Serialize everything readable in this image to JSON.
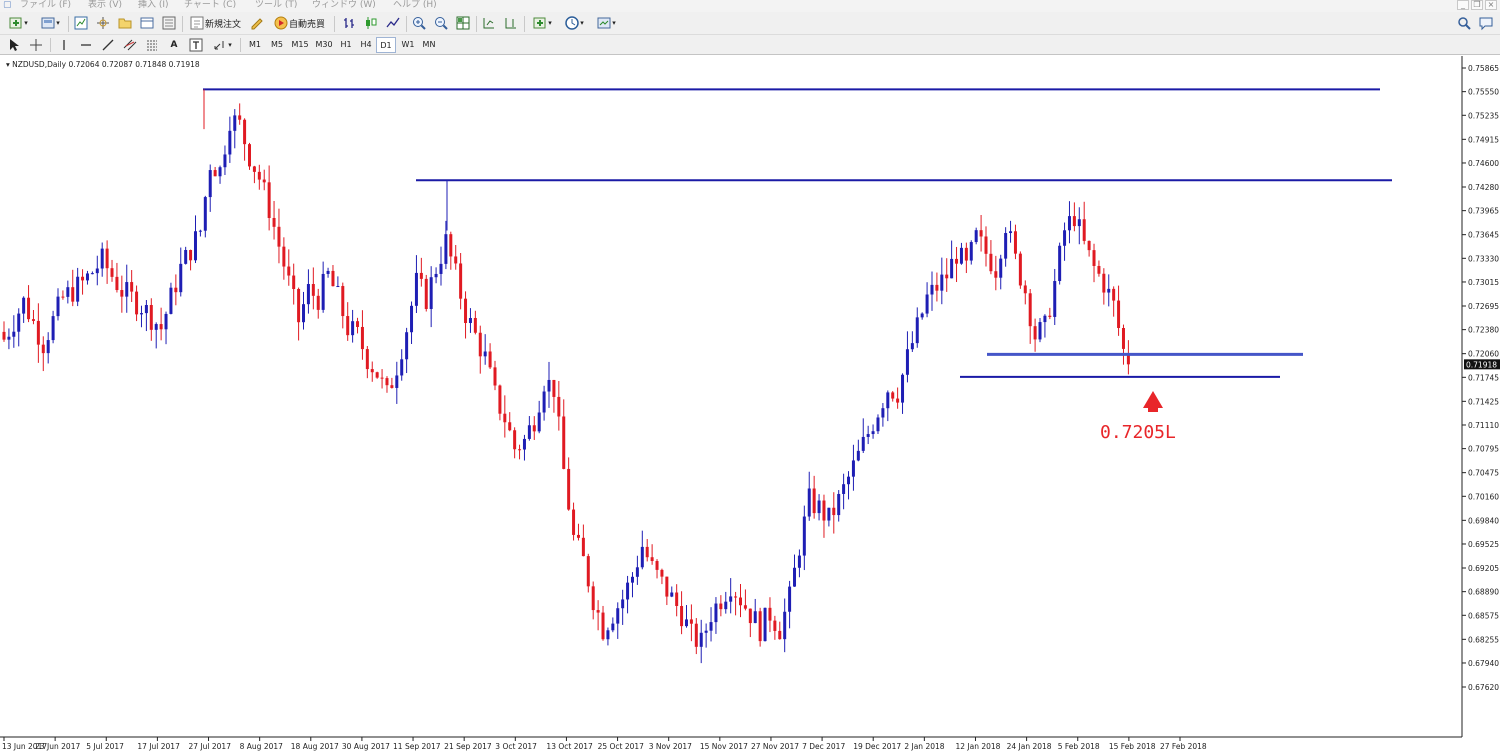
{
  "menu": {
    "items": [
      "ファイル (F)",
      "表示 (V)",
      "挿入 (I)",
      "チャート (C)",
      "ツール (T)",
      "ウィンドウ (W)",
      "ヘルプ (H)"
    ]
  },
  "toolbar": {
    "new_order_label": "新規注文",
    "auto_trade_label": "自動売買",
    "timeframes": [
      "M1",
      "M5",
      "M15",
      "M30",
      "H1",
      "H4",
      "D1",
      "W1",
      "MN"
    ],
    "active_timeframe": "D1"
  },
  "chart_header": {
    "symbol_line": "NZDUSD,Daily  0.72064 0.72087 0.71848 0.71918"
  },
  "annotation": {
    "text": "0.7205L",
    "color": "#e8262a"
  },
  "colors": {
    "bull": "#1e1eb4",
    "bear": "#e01a22",
    "level_line": "#1a1aa6",
    "highlight_line": "#4556c8"
  },
  "chart_data": {
    "type": "candlestick",
    "symbol": "NZDUSD",
    "timeframe": "Daily",
    "y_tick_labels": [
      "0.75865",
      "0.75550",
      "0.75235",
      "0.74915",
      "0.74600",
      "0.74280",
      "0.73965",
      "0.73645",
      "0.73330",
      "0.73015",
      "0.72695",
      "0.72380",
      "0.72060",
      "0.71745",
      "0.71425",
      "0.71110",
      "0.70795",
      "0.70475",
      "0.70160",
      "0.69840",
      "0.69525",
      "0.69205",
      "0.68890",
      "0.68575",
      "0.68255",
      "0.67940",
      "0.67620"
    ],
    "ylim": [
      0.6762,
      0.75865
    ],
    "x_tick_labels": [
      "13 Jun 2017",
      "23 Jun 2017",
      "5 Jul 2017",
      "17 Jul 2017",
      "27 Jul 2017",
      "8 Aug 2017",
      "18 Aug 2017",
      "30 Aug 2017",
      "11 Sep 2017",
      "21 Sep 2017",
      "3 Oct 2017",
      "13 Oct 2017",
      "25 Oct 2017",
      "3 Nov 2017",
      "15 Nov 2017",
      "27 Nov 2017",
      "7 Dec 2017",
      "19 Dec 2017",
      "2 Jan 2018",
      "12 Jan 2018",
      "24 Jan 2018",
      "5 Feb 2018",
      "15 Feb 2018",
      "27 Feb 2018"
    ],
    "current_price": "0.71918",
    "close_path": [
      [
        0,
        0.7225
      ],
      [
        4,
        0.7275
      ],
      [
        8,
        0.722
      ],
      [
        12,
        0.728
      ],
      [
        16,
        0.73
      ],
      [
        20,
        0.733
      ],
      [
        24,
        0.729
      ],
      [
        28,
        0.727
      ],
      [
        32,
        0.724
      ],
      [
        36,
        0.732
      ],
      [
        40,
        0.737
      ],
      [
        42,
        0.746
      ],
      [
        44,
        0.745
      ],
      [
        46,
        0.752
      ],
      [
        48,
        0.751
      ],
      [
        50,
        0.747
      ],
      [
        52,
        0.744
      ],
      [
        54,
        0.74
      ],
      [
        56,
        0.735
      ],
      [
        58,
        0.73
      ],
      [
        60,
        0.725
      ],
      [
        62,
        0.729
      ],
      [
        64,
        0.728
      ],
      [
        66,
        0.731
      ],
      [
        68,
        0.728
      ],
      [
        70,
        0.724
      ],
      [
        72,
        0.723
      ],
      [
        74,
        0.72
      ],
      [
        76,
        0.718
      ],
      [
        78,
        0.715
      ],
      [
        80,
        0.719
      ],
      [
        82,
        0.724
      ],
      [
        84,
        0.73
      ],
      [
        86,
        0.728
      ],
      [
        88,
        0.732
      ],
      [
        90,
        0.7355
      ],
      [
        92,
        0.731
      ],
      [
        94,
        0.726
      ],
      [
        96,
        0.723
      ],
      [
        98,
        0.72
      ],
      [
        100,
        0.715
      ],
      [
        102,
        0.712
      ],
      [
        104,
        0.708
      ],
      [
        106,
        0.709
      ],
      [
        108,
        0.712
      ],
      [
        110,
        0.717
      ],
      [
        112,
        0.716
      ],
      [
        114,
        0.705
      ],
      [
        116,
        0.696
      ],
      [
        118,
        0.693
      ],
      [
        120,
        0.688
      ],
      [
        122,
        0.684
      ],
      [
        124,
        0.686
      ],
      [
        126,
        0.688
      ],
      [
        128,
        0.691
      ],
      [
        130,
        0.695
      ],
      [
        132,
        0.692
      ],
      [
        134,
        0.69
      ],
      [
        136,
        0.688
      ],
      [
        138,
        0.686
      ],
      [
        140,
        0.683
      ],
      [
        142,
        0.682
      ],
      [
        144,
        0.686
      ],
      [
        146,
        0.688
      ],
      [
        148,
        0.69
      ],
      [
        150,
        0.688
      ],
      [
        152,
        0.686
      ],
      [
        154,
        0.684
      ],
      [
        156,
        0.686
      ],
      [
        158,
        0.684
      ],
      [
        160,
        0.688
      ],
      [
        162,
        0.695
      ],
      [
        164,
        0.701
      ],
      [
        166,
        0.7
      ],
      [
        168,
        0.6985
      ],
      [
        170,
        0.701
      ],
      [
        172,
        0.704
      ],
      [
        174,
        0.707
      ],
      [
        176,
        0.71
      ],
      [
        178,
        0.713
      ],
      [
        180,
        0.716
      ],
      [
        182,
        0.7155
      ],
      [
        184,
        0.72
      ],
      [
        186,
        0.724
      ],
      [
        188,
        0.728
      ],
      [
        190,
        0.7295
      ],
      [
        192,
        0.731
      ],
      [
        194,
        0.734
      ],
      [
        196,
        0.732
      ],
      [
        198,
        0.736
      ],
      [
        200,
        0.734
      ],
      [
        202,
        0.732
      ],
      [
        204,
        0.738
      ],
      [
        206,
        0.733
      ],
      [
        208,
        0.729
      ],
      [
        210,
        0.723
      ],
      [
        212,
        0.724
      ],
      [
        214,
        0.73
      ],
      [
        216,
        0.737
      ],
      [
        218,
        0.739
      ],
      [
        220,
        0.735
      ],
      [
        222,
        0.732
      ],
      [
        224,
        0.73
      ],
      [
        226,
        0.727
      ],
      [
        228,
        0.721
      ],
      [
        229,
        0.7192
      ]
    ],
    "levels": [
      {
        "price": 0.7558,
        "from_date": "21 Jul 2017"
      },
      {
        "price": 0.7437,
        "from_date": "11 Sep 2017"
      },
      {
        "price": 0.7205,
        "from_date": "12 Jan 2018"
      },
      {
        "price": 0.7175,
        "from_date": "9 Jan 2018"
      }
    ]
  }
}
